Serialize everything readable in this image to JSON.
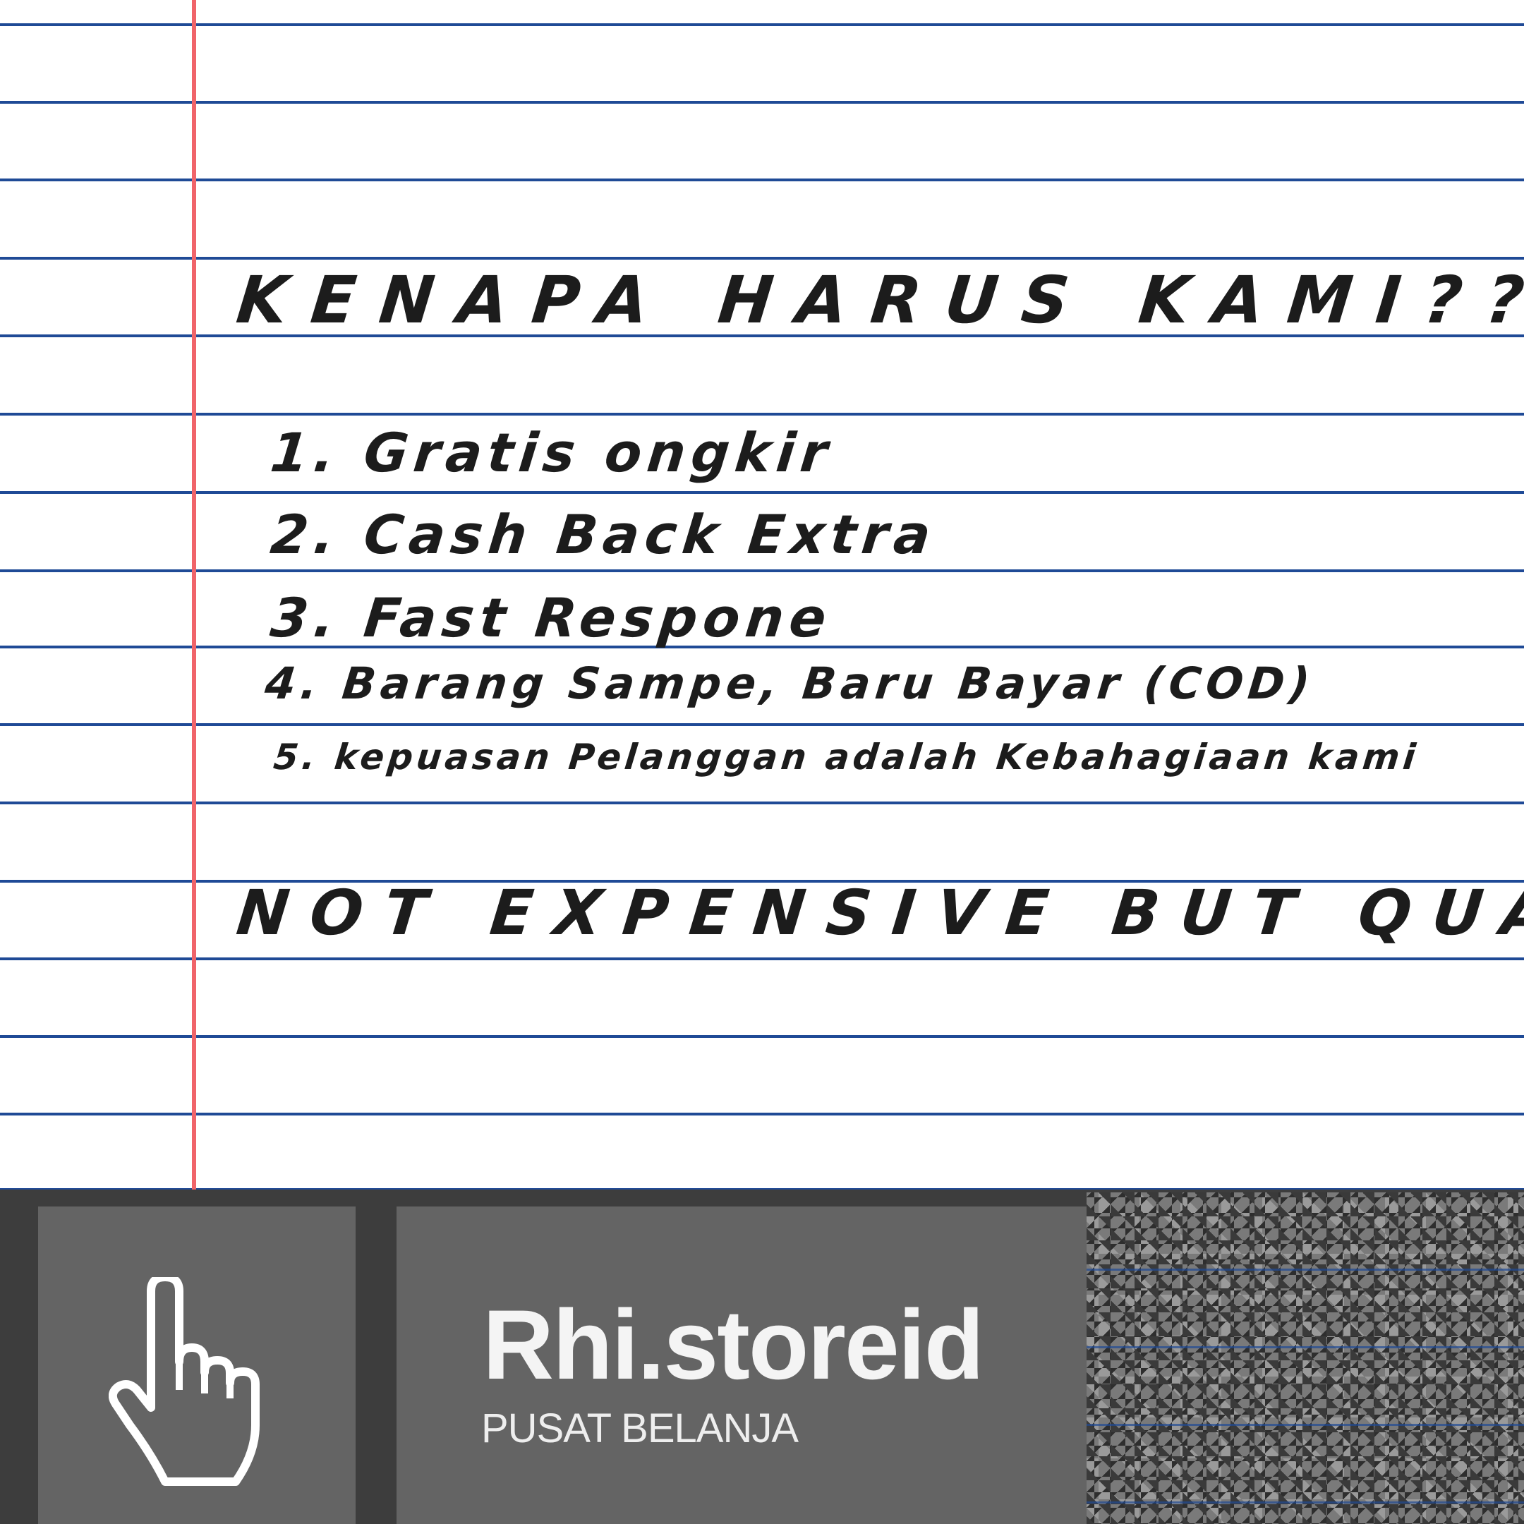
{
  "note": {
    "heading": "KENAPA HARUS KAMI??",
    "items": [
      "1. Gratis ongkir",
      "2. Cash Back Extra",
      "3. Fast Respone",
      "4. Barang Sampe, Baru Bayar (COD)",
      "5. kepuasan Pelanggan adalah Kebahagiaan kami"
    ],
    "tagline": "NOT EXPENSIVE BUT QUALITY",
    "colors": {
      "rule_line": "#1f4a96",
      "margin_line": "#f0646a",
      "ink": "#1c1c1c"
    }
  },
  "store": {
    "name": "Rhi.storeid",
    "subtitle": "PUSAT BELANJA",
    "icon": "pointing-hand-icon",
    "colors": {
      "panel": "#646464",
      "background": "#3d3d3d",
      "text": "#f4f4f4"
    }
  }
}
